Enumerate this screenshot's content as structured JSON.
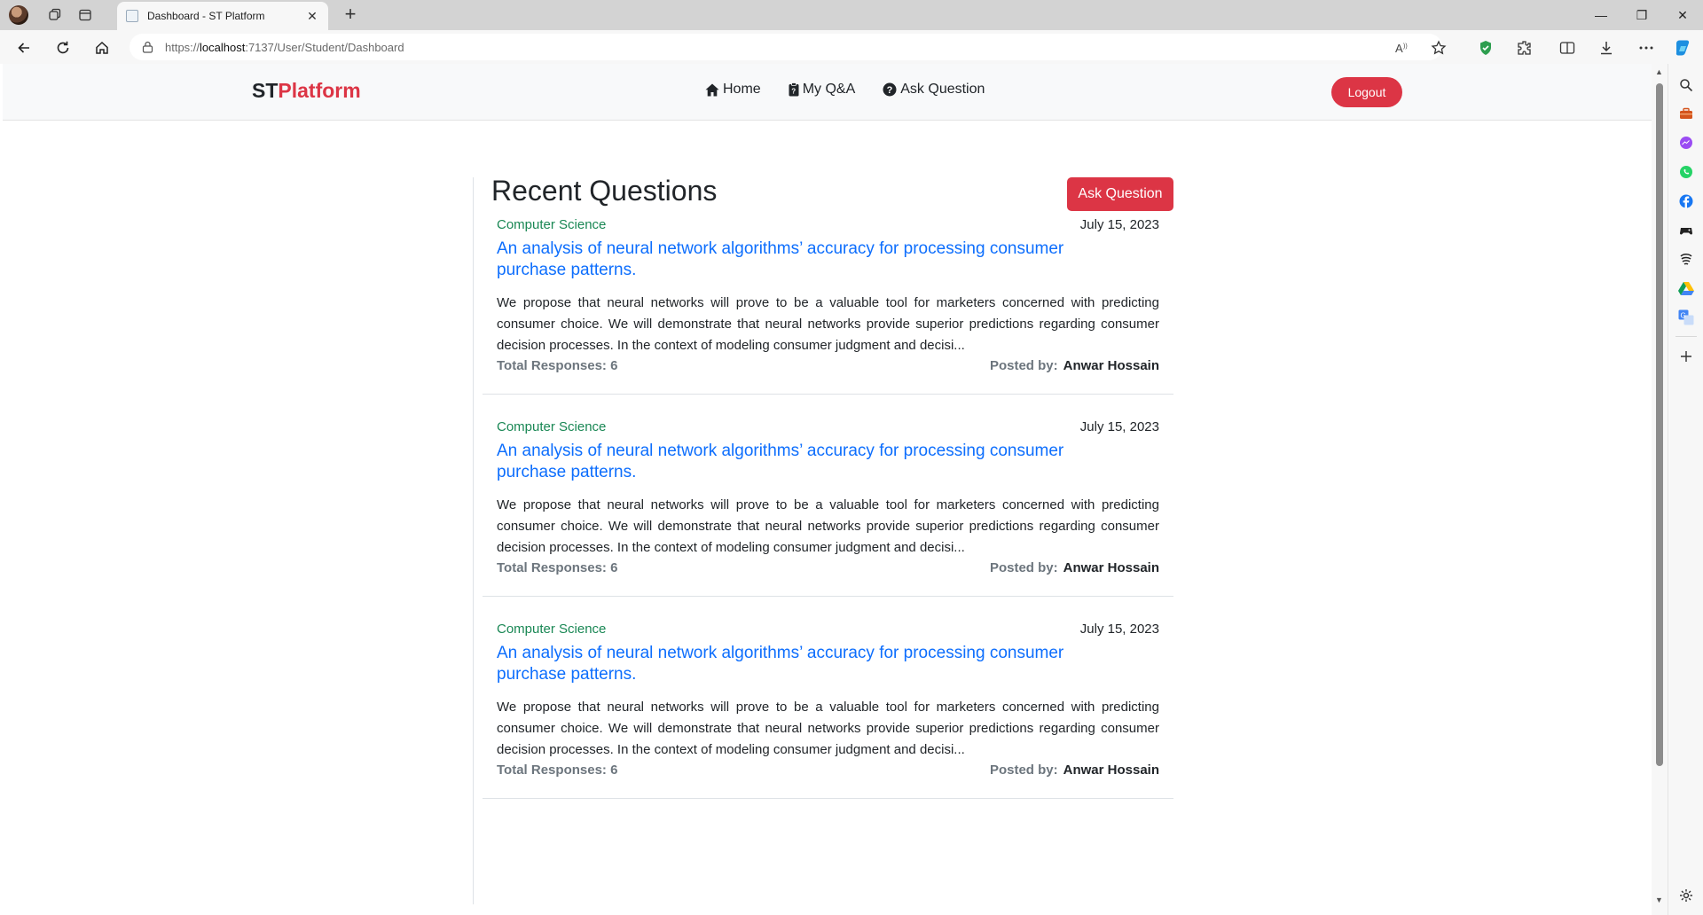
{
  "browser": {
    "tab_title": "Dashboard - ST Platform",
    "url_prefix": "https://",
    "url_host": "localhost",
    "url_rest": ":7137/User/Student/Dashboard"
  },
  "site": {
    "brand_st": "ST",
    "brand_platform": "Platform",
    "nav": {
      "home": "Home",
      "my_qa": "My Q&A",
      "ask_question": "Ask Question"
    },
    "logout": "Logout"
  },
  "main": {
    "heading": "Recent Questions",
    "ask_button": "Ask Question",
    "questions": [
      {
        "category": "Computer Science",
        "date": "July 15, 2023",
        "title": "An analysis of neural network algorithms’ accuracy for processing consumer purchase patterns.",
        "body": "We propose that neural networks will prove to be a valuable tool for marketers concerned with predicting consumer choice. We will demonstrate that neural networks provide superior predictions regarding consumer decision processes. In the context of modeling consumer judgment and decisi...",
        "responses": "Total Responses: 6",
        "posted_label": "Posted by:",
        "author": "Anwar Hossain"
      },
      {
        "category": "Computer Science",
        "date": "July 15, 2023",
        "title": "An analysis of neural network algorithms’ accuracy for processing consumer purchase patterns.",
        "body": "We propose that neural networks will prove to be a valuable tool for marketers concerned with predicting consumer choice. We will demonstrate that neural networks provide superior predictions regarding consumer decision processes. In the context of modeling consumer judgment and decisi...",
        "responses": "Total Responses: 6",
        "posted_label": "Posted by:",
        "author": "Anwar Hossain"
      },
      {
        "category": "Computer Science",
        "date": "July 15, 2023",
        "title": "An analysis of neural network algorithms’ accuracy for processing consumer purchase patterns.",
        "body": "We propose that neural networks will prove to be a valuable tool for marketers concerned with predicting consumer choice. We will demonstrate that neural networks provide superior predictions regarding consumer decision processes. In the context of modeling consumer judgment and decisi...",
        "responses": "Total Responses: 6",
        "posted_label": "Posted by:",
        "author": "Anwar Hossain"
      }
    ]
  },
  "colors": {
    "brand_red": "#dc3545",
    "category_green": "#198754",
    "title_blue": "#0d6efd",
    "muted": "#6c757d"
  }
}
